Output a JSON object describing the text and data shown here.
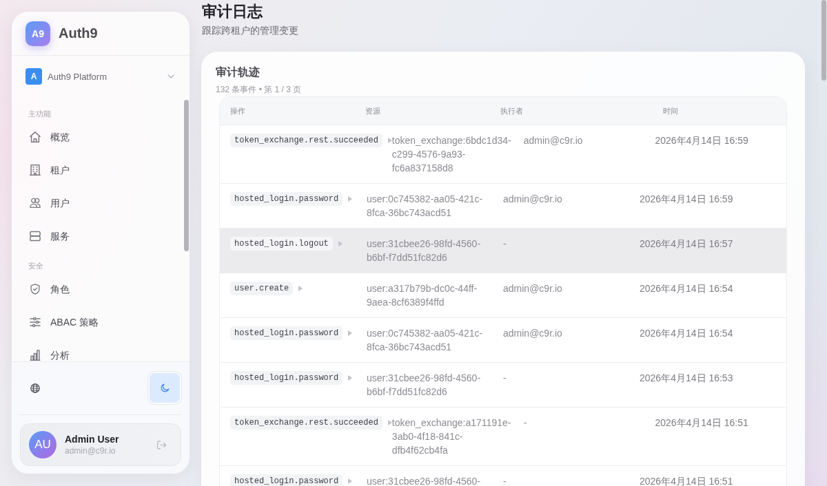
{
  "sidebar": {
    "logo": {
      "mark": "A9",
      "name": "Auth9"
    },
    "tenant": {
      "initial": "A",
      "name": "Auth9 Platform"
    },
    "sections": [
      {
        "label": "主功能",
        "items": [
          {
            "label": "概览",
            "selected": false
          },
          {
            "label": "租户",
            "selected": false
          },
          {
            "label": "用户",
            "selected": false
          },
          {
            "label": "服务",
            "selected": false
          }
        ]
      },
      {
        "label": "安全",
        "items": [
          {
            "label": "角色",
            "selected": false
          },
          {
            "label": "ABAC 策略",
            "selected": false
          },
          {
            "label": "分析",
            "selected": false
          }
        ]
      }
    ],
    "user": {
      "initials": "AU",
      "name": "Admin User",
      "email": "admin@c9r.io"
    }
  },
  "page": {
    "title": "审计日志",
    "subtitle": "跟踪跨租户的管理变更"
  },
  "audit_card": {
    "title": "审计轨迹",
    "summary": "132 条事件 • 第 1 / 3 页",
    "columns": [
      "操作",
      "资源",
      "执行者",
      "时间"
    ],
    "rows": [
      {
        "action": "token_exchange.rest.succeeded",
        "resource": "token_exchange:6bdc1d34-c299-4576-9a93-fc6a837158d8",
        "actor": "admin@c9r.io",
        "time": "2026年4月14日 16:59",
        "highlighted": false
      },
      {
        "action": "hosted_login.password",
        "resource": "user:0c745382-aa05-421c-8fca-36bc743acd51",
        "actor": "admin@c9r.io",
        "time": "2026年4月14日 16:59",
        "highlighted": false
      },
      {
        "action": "hosted_login.logout",
        "resource": "user:31cbee26-98fd-4560-b6bf-f7dd51fc82d6",
        "actor": "-",
        "time": "2026年4月14日 16:57",
        "highlighted": true
      },
      {
        "action": "user.create",
        "resource": "user:a317b79b-dc0c-44ff-9aea-8cf6389f4ffd",
        "actor": "admin@c9r.io",
        "time": "2026年4月14日 16:54",
        "highlighted": false
      },
      {
        "action": "hosted_login.password",
        "resource": "user:0c745382-aa05-421c-8fca-36bc743acd51",
        "actor": "admin@c9r.io",
        "time": "2026年4月14日 16:54",
        "highlighted": false
      },
      {
        "action": "hosted_login.password",
        "resource": "user:31cbee26-98fd-4560-b6bf-f7dd51fc82d6",
        "actor": "-",
        "time": "2026年4月14日 16:53",
        "highlighted": false
      },
      {
        "action": "token_exchange.rest.succeeded",
        "resource": "token_exchange:a171191e-3ab0-4f18-841c-dfb4f62cb4fa",
        "actor": "-",
        "time": "2026年4月14日 16:51",
        "highlighted": false
      },
      {
        "action": "hosted_login.password",
        "resource": "user:31cbee26-98fd-4560-",
        "actor": "-",
        "time": "2026年4月14日 16:51",
        "highlighted": false
      }
    ]
  }
}
